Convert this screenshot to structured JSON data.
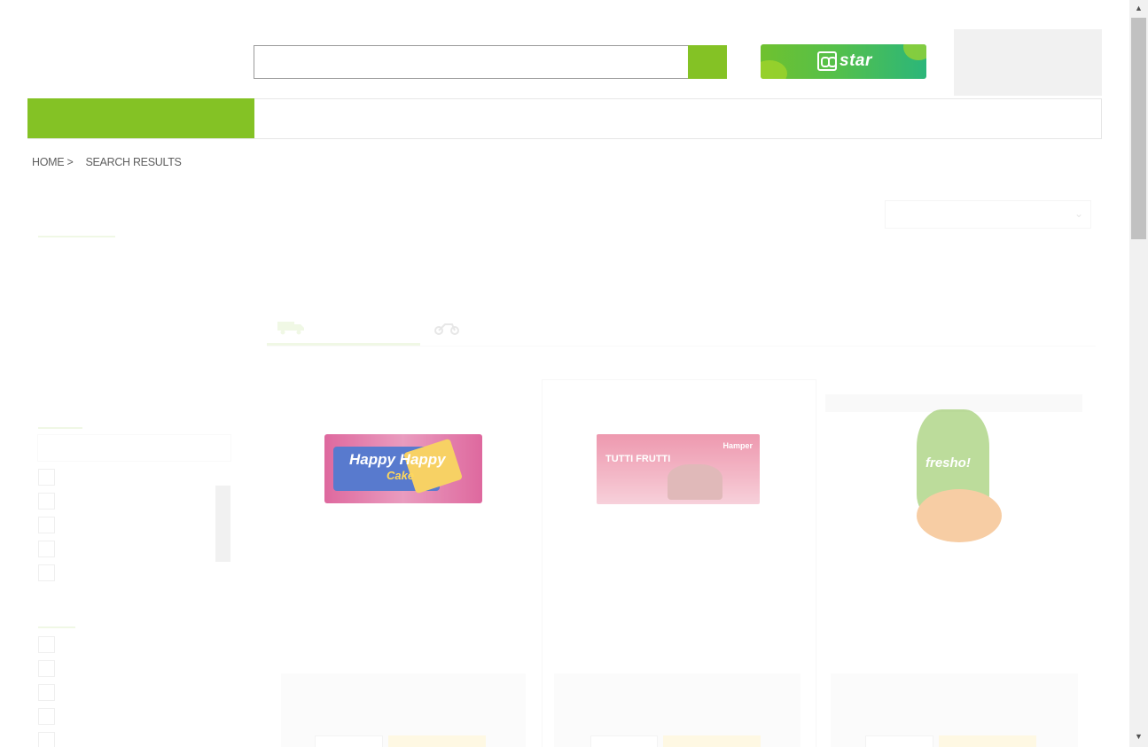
{
  "header": {
    "search": {
      "value": "",
      "placeholder": ""
    },
    "bbstar_banner": {
      "text": "star",
      "colors": [
        "#6fc12f",
        "#2bb67a"
      ]
    }
  },
  "accent_color": "#84c225",
  "breadcrumb": {
    "home": "HOME >",
    "current": "SEARCH RESULTS"
  },
  "products": [
    {
      "image_name": "happy-happy-biscuit-image"
    },
    {
      "image_name": "tutti-frutti-cake-image"
    },
    {
      "image_name": "fresho-bread-image"
    }
  ],
  "product_art_text": {
    "happy_happy": "Happy Happy",
    "happy_sub": "Cake",
    "tutti": "TUTTI FRUTTI",
    "tutti_brand": "Hamper",
    "fresho": "fresho!"
  }
}
